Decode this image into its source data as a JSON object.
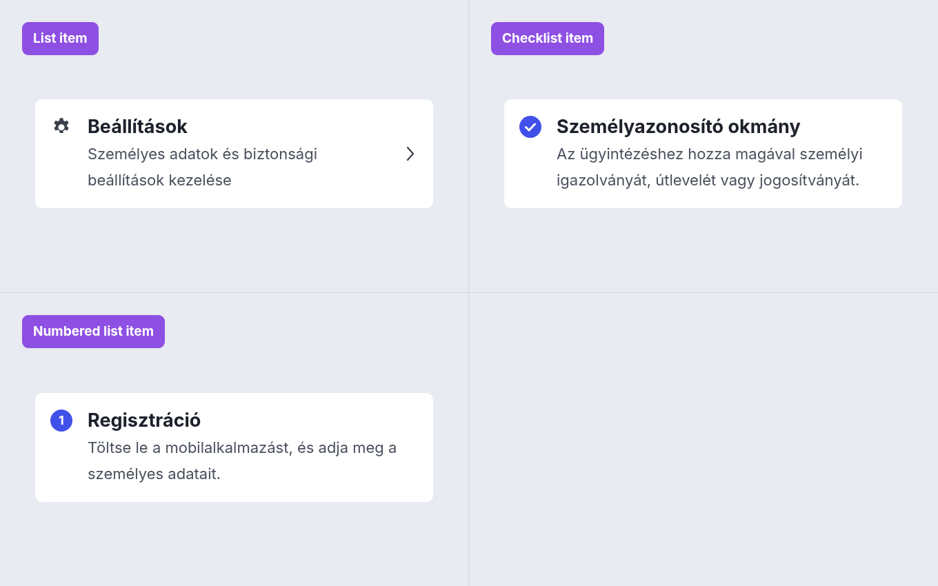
{
  "panels": [
    {
      "label": "List item",
      "item": {
        "kind": "list",
        "title": "Beállítások",
        "description": "Személyes adatok és biztonsági beállítások kezelése"
      }
    },
    {
      "label": "Checklist item",
      "item": {
        "kind": "checklist",
        "checked": true,
        "title": "Személyazonosító okmány",
        "description": "Az ügyintézéshez hozza magával személyi igazolványát, útlevelét vagy jogosítványát."
      }
    },
    {
      "label": "Numbered list item",
      "item": {
        "kind": "numbered",
        "number": "1",
        "title": "Regisztráció",
        "description": "Töltse le a mobilalkalmazást, és adja meg a személyes adatait."
      }
    }
  ]
}
